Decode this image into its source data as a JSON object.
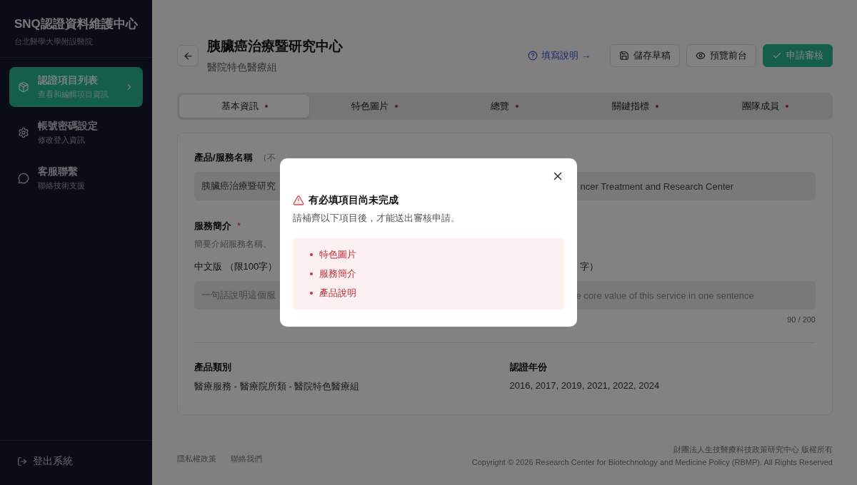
{
  "sidebar": {
    "title": "SNQ認證資料維護中心",
    "subtitle": "台北醫學大學附設醫院",
    "items": [
      {
        "kind": "box",
        "label": "認證項目列表",
        "sub": "查看和編輯項目資訊",
        "selected": true
      },
      {
        "kind": "gear",
        "label": "帳號密碼設定",
        "sub": "修改登入資訊",
        "selected": false
      },
      {
        "kind": "chat",
        "label": "客服聯繫",
        "sub": "聯絡技術支援",
        "selected": false
      }
    ],
    "logout": "登出系統"
  },
  "header": {
    "title": "胰臟癌治療暨研究中心",
    "subtitle": "醫院特色醫療組",
    "help_link": "填寫說明 →",
    "buttons": [
      {
        "kind": "save",
        "label": "儲存草稿"
      },
      {
        "kind": "preview",
        "label": "預覽前台"
      },
      {
        "kind": "submit",
        "label": "申請審核"
      }
    ]
  },
  "tabs": [
    {
      "label": "基本資訊",
      "selected": true,
      "incomplete": true
    },
    {
      "label": "特色圖片",
      "selected": false,
      "incomplete": true
    },
    {
      "label": "總覽",
      "selected": false,
      "incomplete": true
    },
    {
      "label": "關鍵指標",
      "selected": false,
      "incomplete": true
    },
    {
      "label": "團隊成員",
      "selected": false,
      "incomplete": true
    }
  ],
  "form": {
    "name_label": "產品/服務名稱",
    "name_note": "（不",
    "name_zh": "胰臟癌治療暨研究",
    "name_en": "ncer Treatment and Research Center",
    "intro_label": "服務簡介",
    "intro_required": true,
    "required_mark": "*",
    "intro_hint": "簡要介紹服務名稱、",
    "zh_label": "中文版 （限100字）",
    "en_label": "字）",
    "zh_placeholder": "一句話說明這個服",
    "en_placeholder": "e core value of this service in one sentence",
    "en_count": "90 / 200"
  },
  "info": [
    {
      "label": "產品類別",
      "value": "醫療服務 - 醫療院所類 - 醫院特色醫療組"
    },
    {
      "label": "認證年份",
      "value": "2016, 2017, 2019, 2021, 2022, 2024"
    }
  ],
  "footer": {
    "links": [
      "隱私權政策",
      "聯絡我們"
    ],
    "org": "財團法人生技醫療科技政策研究中心 版權所有",
    "copyright": "Copyright © 2026 Research Center for Biotechnology and Medicine Policy (RBMP). All Rights Reserved"
  },
  "modal": {
    "title": "有必填項目尚未完成",
    "message": "請補齊以下項目後，才能送出審核申請。",
    "items": [
      "特色圖片",
      "服務簡介",
      "產品說明"
    ]
  }
}
